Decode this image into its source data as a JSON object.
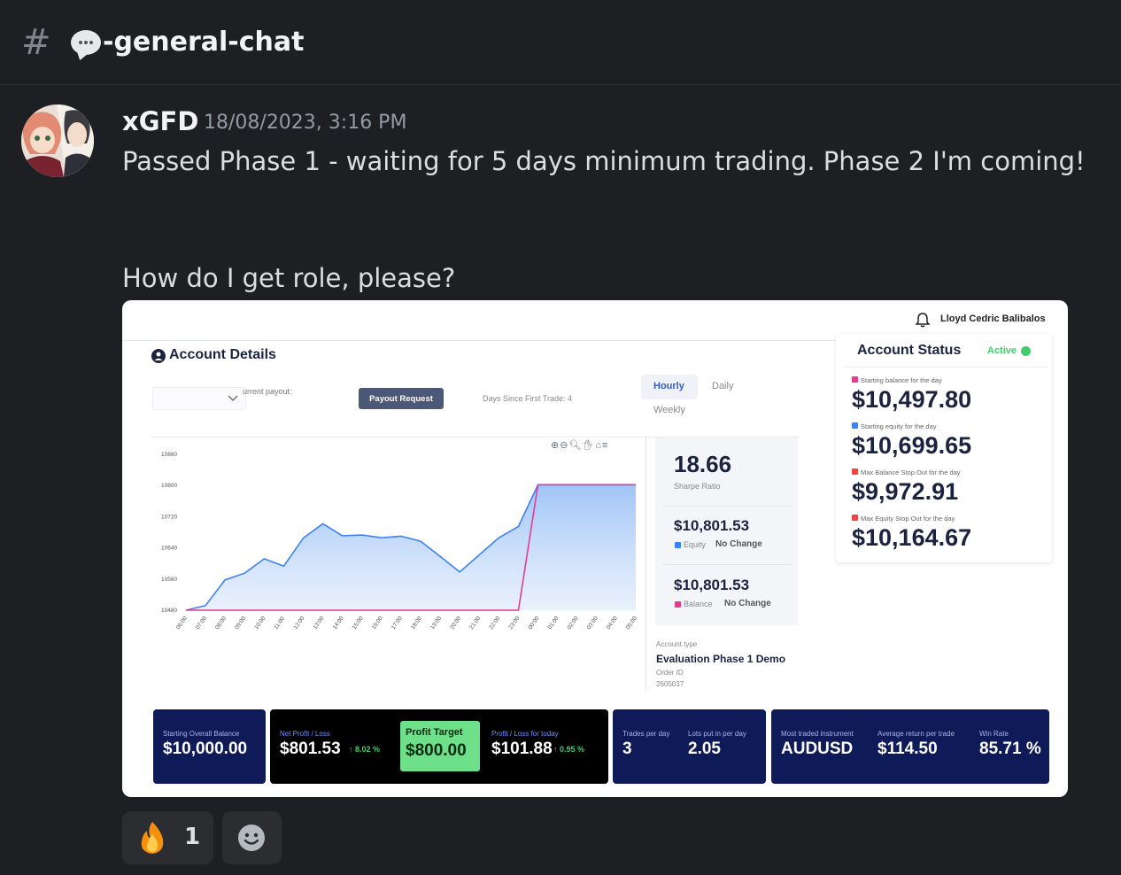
{
  "channel": {
    "hash": "#",
    "name": "-general-chat",
    "icon": "speech-bubble-icon"
  },
  "message": {
    "author": "xGFD",
    "timestamp": "18/08/2023, 3:16 PM",
    "line1": "Passed Phase 1 - waiting for 5 days minimum trading. Phase 2 I'm coming!",
    "line2": "How do I get role, please?"
  },
  "embed": {
    "user_name": "Lloyd Cedric Balibalos",
    "title": "Account Details",
    "current_payout_label": "urrent payout:",
    "payout_button": "Payout Request",
    "days_since": "Days Since First Trade: 4",
    "tabs": [
      "Hourly",
      "Daily",
      "Weekly"
    ],
    "active_tab": "Hourly",
    "stats": {
      "sharpe_value": "18.66",
      "sharpe_label": "Sharpe Ratio",
      "equity_value": "$10,801.53",
      "equity_label": "Equity",
      "equity_change": "No Change",
      "balance_value": "$10,801.53",
      "balance_label": "Balance",
      "balance_change": "No Change"
    },
    "account_type_label": "Account type",
    "account_type": "Evaluation Phase 1 Demo",
    "order_id_label": "Order ID",
    "order_id": "2605037",
    "status": {
      "title": "Account Status",
      "state": "Active",
      "items": [
        {
          "label": "Starting balance for the day",
          "value": "$10,497.80",
          "color": "#e43d8f"
        },
        {
          "label": "Starting equity for the day",
          "value": "$10,699.65",
          "color": "#3b82f6"
        },
        {
          "label": "Max Balance Stop Out for the day",
          "value": "$9,972.91",
          "color": "#ef4444"
        },
        {
          "label": "Max Equity Stop Out for the day",
          "value": "$10,164.67",
          "color": "#ef4444"
        }
      ]
    },
    "cards": {
      "starting_label": "Starting Overall Balance",
      "starting_value": "$10,000.00",
      "net_label": "Net Profit / Loss",
      "net_value": "$801.53",
      "net_pct": "↑ 8.02 %",
      "target_label": "Profit Target",
      "target_value": "$800.00",
      "today_label": "Profit / Loss for today",
      "today_value": "$101.88",
      "today_pct": "↑ 0.95 %",
      "trades_label": "Trades per day",
      "trades_value": "3",
      "lots_label": "Lots put in per day",
      "lots_value": "2.05",
      "instrument_label": "Most traded instrument",
      "instrument_value": "AUDUSD",
      "avgret_label": "Average return per trade",
      "avgret_value": "$114.50",
      "winrate_label": "Win Rate",
      "winrate_value": "85.71 %"
    }
  },
  "reactions": [
    {
      "emoji": "fire-icon",
      "count": "1"
    },
    {
      "emoji": "add-reaction-icon",
      "count": ""
    }
  ],
  "chart_data": {
    "type": "area",
    "x": [
      "06:00",
      "07:00",
      "08:00",
      "09:00",
      "10:00",
      "11:00",
      "12:00",
      "13:00",
      "14:00",
      "15:00",
      "16:00",
      "17:00",
      "18:00",
      "19:00",
      "20:00",
      "21:00",
      "22:00",
      "23:00",
      "00:00",
      "01:00",
      "02:00",
      "03:00",
      "04:00",
      "05:00"
    ],
    "yticks": [
      "10880",
      "10800",
      "10720",
      "10640",
      "10560",
      "10480"
    ],
    "ylim": [
      10480,
      10880
    ],
    "series": [
      {
        "values": [
          10480,
          10492,
          10558,
          10575,
          10612,
          10593,
          10665,
          10702,
          10671,
          10673,
          10666,
          10670,
          10657,
          10618,
          10578,
          10622,
          10666,
          10695,
          10802,
          10802,
          10802,
          10802,
          10802,
          10802
        ],
        "color": "#3b82f6"
      },
      {
        "values": [
          10480,
          10480,
          10480,
          10480,
          10480,
          10480,
          10480,
          10480,
          10480,
          10480,
          10480,
          10480,
          10480,
          10480,
          10480,
          10480,
          10480,
          10480,
          10802,
          10802,
          10802,
          10802,
          10802,
          10802
        ],
        "color": "#e43d8f"
      }
    ],
    "grid": false
  }
}
